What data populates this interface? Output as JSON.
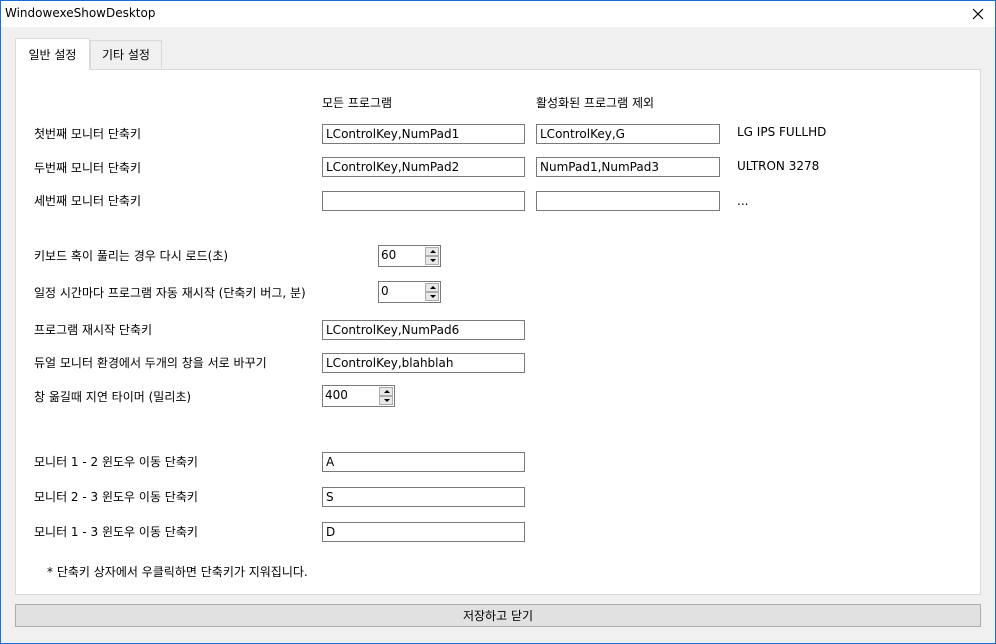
{
  "window": {
    "title": "WindowexeShowDesktop"
  },
  "tabs": [
    {
      "label": "일반 설정"
    },
    {
      "label": "기타 설정"
    }
  ],
  "headers": {
    "all_programs": "모든 프로그램",
    "exclude_active": "활성화된 프로그램 제외"
  },
  "monitors": [
    {
      "label": "첫번째 모니터 단축키",
      "all": "LControlKey,NumPad1",
      "exclude": "LControlKey,G",
      "name": "LG IPS FULLHD"
    },
    {
      "label": "두번째 모니터 단축키",
      "all": "LControlKey,NumPad2",
      "exclude": "NumPad1,NumPad3",
      "name": "ULTRON 3278"
    },
    {
      "label": "세번째 모니터 단축키",
      "all": "",
      "exclude": "",
      "name": "..."
    }
  ],
  "reload": {
    "label": "키보드 혹이 풀리는 경우 다시 로드(초)",
    "value": "60"
  },
  "restart_interval": {
    "label": "일정 시간마다 프로그램 자동 재시작 (단축키 버그, 분)",
    "value": "0"
  },
  "restart_hotkey": {
    "label": "프로그램 재시작 단축키",
    "value": "LControlKey,NumPad6"
  },
  "swap": {
    "label": "듀얼 모니터 환경에서 두개의 창을 서로 바꾸기",
    "value": "LControlKey,blahblah"
  },
  "delay": {
    "label": "창 옮길때 지연 타이머 (밀리초)",
    "value": "400"
  },
  "moves": [
    {
      "label": "모니터 1 - 2 윈도우 이동 단축키",
      "value": "A"
    },
    {
      "label": "모니터 2 - 3 윈도우 이동 단축키",
      "value": "S"
    },
    {
      "label": "모니터 1 - 3 윈도우 이동 단축키",
      "value": "D"
    }
  ],
  "note": "* 단축키 상자에서 우클릭하면 단축키가 지워집니다.",
  "save_button": "저장하고 닫기",
  "colors": {
    "border": "#1a6fd6"
  }
}
